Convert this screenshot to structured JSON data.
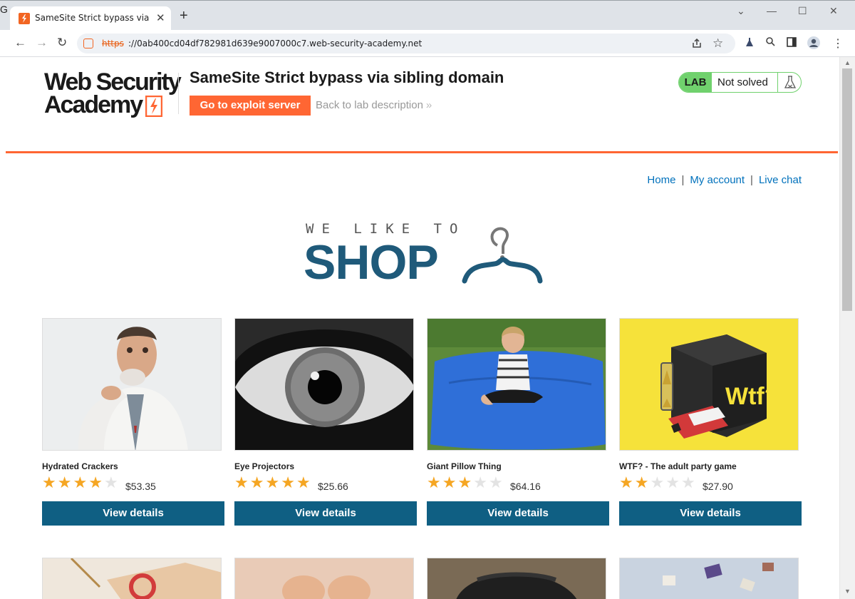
{
  "browser": {
    "tab_title": "SameSite Strict bypass via sibling domain",
    "tab_close": "✕",
    "new_tab": "+",
    "url_scheme": "https",
    "url_rest": "://0ab400cd04df782981d639e9007000c7.web-security-academy.net",
    "stray_glyph": "G",
    "nav": {
      "back": "←",
      "forward": "→",
      "reload": "↻"
    },
    "window_controls": {
      "minimize": "—",
      "maximize": "☐",
      "close": "✕",
      "menu": "⌄"
    }
  },
  "lab": {
    "logo_line1": "Web Security",
    "logo_line2": "Academy",
    "title": "SameSite Strict bypass via sibling domain",
    "exploit_button": "Go to exploit server",
    "back_link": "Back to lab description",
    "back_chevron": "»",
    "status_badge": "LAB",
    "status_text": "Not solved",
    "accent_color": "#ff6633",
    "status_color": "#70d16d"
  },
  "nav": {
    "home": "Home",
    "separator": "|",
    "my_account": "My account",
    "live_chat": "Live chat"
  },
  "banner": {
    "tagline": "WE LIKE TO",
    "headline": "SHOP"
  },
  "products": [
    {
      "name": "Hydrated Crackers",
      "price": "$53.35",
      "rating": 4,
      "button": "View details"
    },
    {
      "name": "Eye Projectors",
      "price": "$25.66",
      "rating": 5,
      "button": "View details"
    },
    {
      "name": "Giant Pillow Thing",
      "price": "$64.16",
      "rating": 3,
      "button": "View details"
    },
    {
      "name": "WTF? - The adult party game",
      "price": "$27.90",
      "rating": 2,
      "button": "View details"
    }
  ],
  "product_art": {
    "box_label": "Wtf?"
  },
  "colors": {
    "button_blue": "#0f5f83",
    "link_blue": "#0071bc",
    "star": "#f5a623",
    "banner_blue": "#1f5a7a"
  }
}
